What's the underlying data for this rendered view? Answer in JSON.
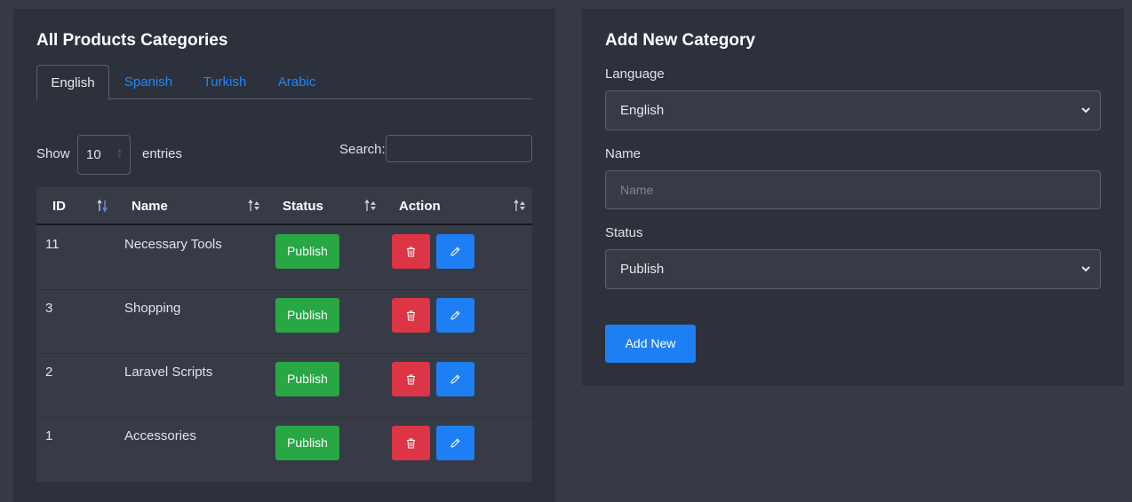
{
  "left": {
    "title": "All Products Categories",
    "tabs": [
      {
        "label": "English",
        "active": true
      },
      {
        "label": "Spanish",
        "active": false
      },
      {
        "label": "Turkish",
        "active": false
      },
      {
        "label": "Arabic",
        "active": false
      }
    ],
    "show_label": "Show",
    "entries_value": "10",
    "entries_label": "entries",
    "search_label": "Search:",
    "search_value": "",
    "columns": [
      "ID",
      "Name",
      "Status",
      "Action"
    ],
    "rows": [
      {
        "id": "11",
        "name": "Necessary Tools",
        "status": "Publish"
      },
      {
        "id": "3",
        "name": "Shopping",
        "status": "Publish"
      },
      {
        "id": "2",
        "name": "Laravel Scripts",
        "status": "Publish"
      },
      {
        "id": "1",
        "name": "Accessories",
        "status": "Publish"
      }
    ]
  },
  "right": {
    "title": "Add New Category",
    "language_label": "Language",
    "language_value": "English",
    "name_label": "Name",
    "name_placeholder": "Name",
    "status_label": "Status",
    "status_value": "Publish",
    "add_button": "Add New"
  },
  "colors": {
    "background": "#353a46",
    "card": "#2c313c",
    "publish": "#28a745",
    "delete": "#dc3545",
    "primary": "#1e7ff5",
    "link": "#1e88ff"
  },
  "icons": {
    "delete": "trash-icon",
    "edit": "pencil-icon",
    "select": "chevron-down-icon",
    "sort": "sort-icon"
  }
}
